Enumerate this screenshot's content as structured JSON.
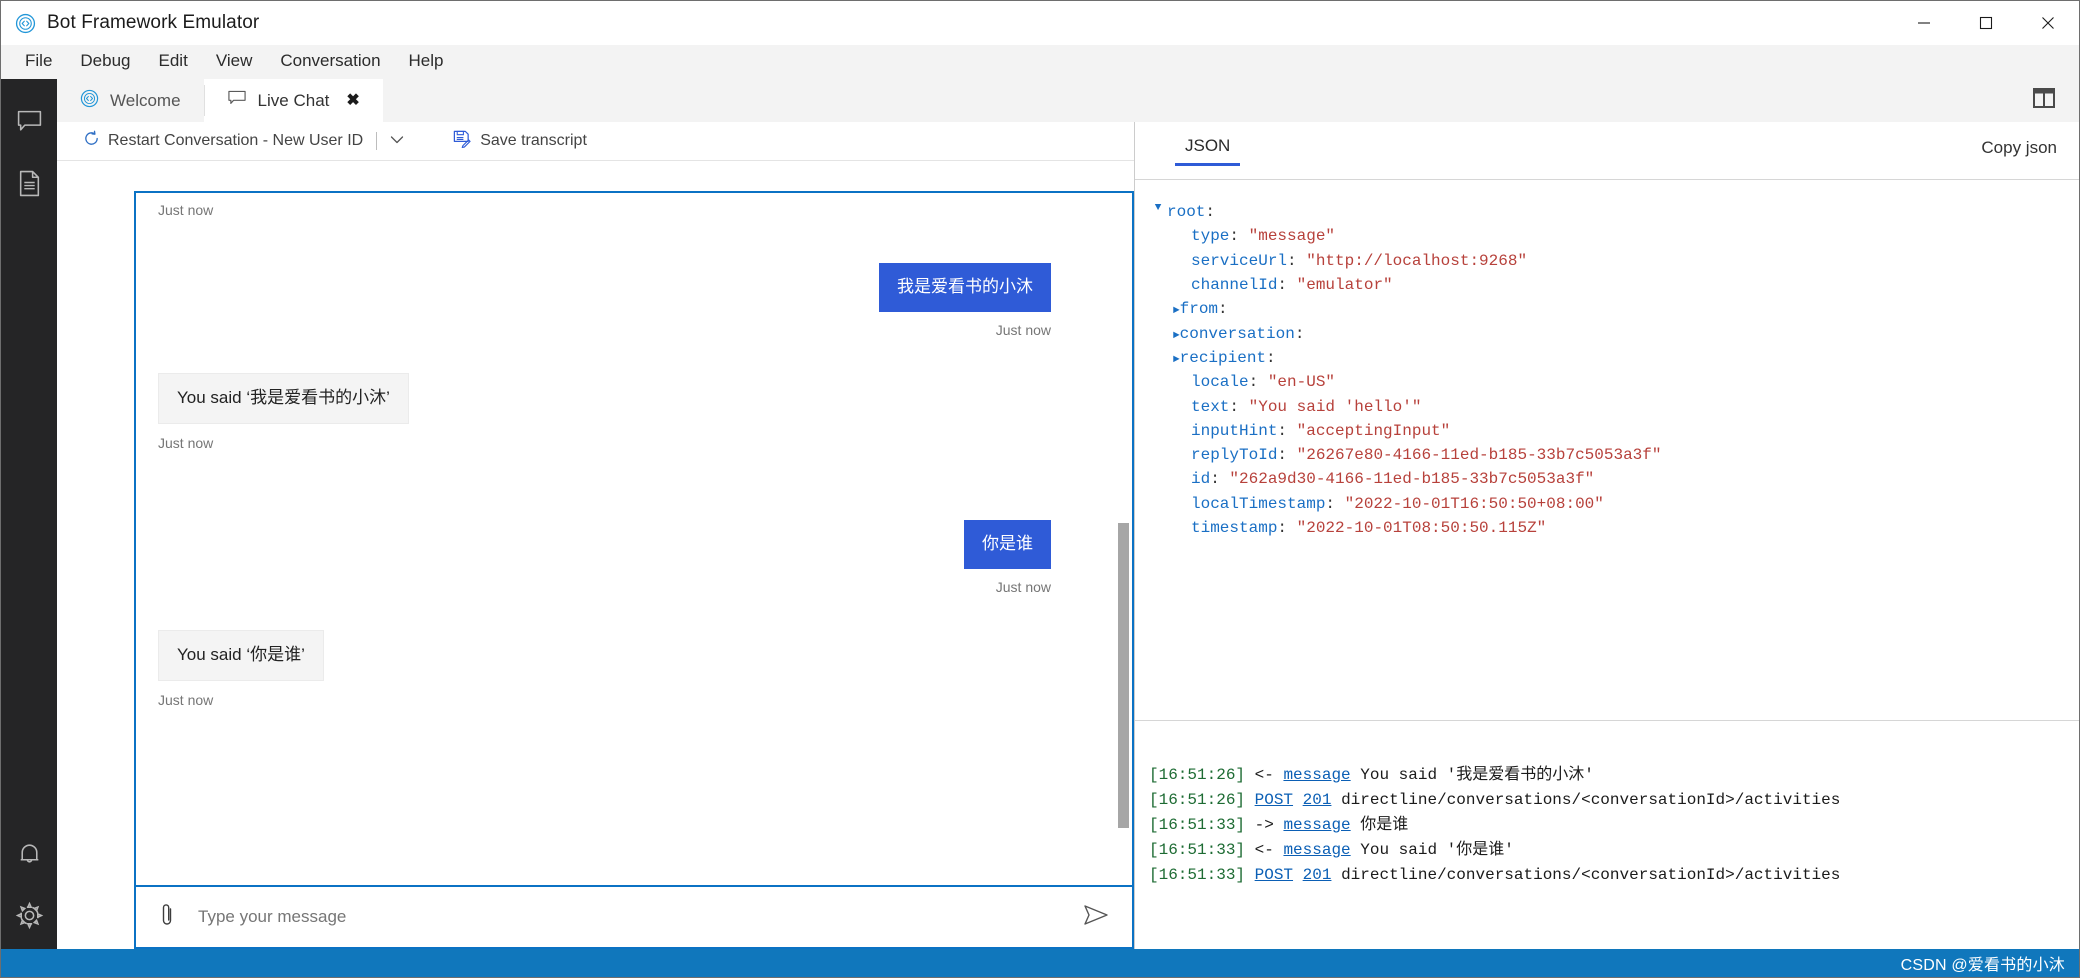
{
  "window": {
    "title": "Bot Framework Emulator",
    "logo_icon": "bot-framework-logo-icon",
    "controls": [
      {
        "name": "minimize-button",
        "icon": "minimize-icon"
      },
      {
        "name": "maximize-button",
        "icon": "maximize-icon"
      },
      {
        "name": "close-button",
        "icon": "close-icon"
      }
    ]
  },
  "menubar": {
    "items": [
      {
        "label": "File"
      },
      {
        "label": "Debug"
      },
      {
        "label": "Edit"
      },
      {
        "label": "View"
      },
      {
        "label": "Conversation"
      },
      {
        "label": "Help"
      }
    ]
  },
  "activity_bar": {
    "items": [
      {
        "name": "sidebar-item-chat",
        "icon": "chat-bubble-icon"
      },
      {
        "name": "sidebar-item-resources",
        "icon": "document-icon"
      },
      {
        "name": "sidebar-item-notifications",
        "icon": "bell-icon"
      },
      {
        "name": "sidebar-item-settings",
        "icon": "gear-icon"
      }
    ]
  },
  "tabs": {
    "items": [
      {
        "label": "Welcome",
        "icon": "bot-framework-logo-icon",
        "active": false,
        "closable": false
      },
      {
        "label": "Live Chat",
        "icon": "chat-bubble-icon",
        "active": true,
        "closable": true,
        "close_glyph": "✖"
      }
    ],
    "layout_button": {
      "name": "toggle-panel-layout-button",
      "icon": "split-panel-icon"
    }
  },
  "chat_toolbar": {
    "restart_label": "Restart Conversation - New User ID",
    "restart_icon": "restart-circular-arrow-icon",
    "restart_caret_icon": "chevron-down-icon",
    "save_transcript_label": "Save transcript",
    "save_transcript_icon": "save-disk-icon"
  },
  "transcript": {
    "top_timestamp": "Just now",
    "messages": [
      {
        "from": "user",
        "text": "我是爱看书的小沐",
        "timestamp": "Just now"
      },
      {
        "from": "bot",
        "text": "You said ‘我是爱看书的小沐’",
        "timestamp": "Just now"
      },
      {
        "from": "user",
        "text": "你是谁",
        "timestamp": "Just now"
      },
      {
        "from": "bot",
        "text": "You said ‘你是谁’",
        "timestamp": "Just now"
      }
    ],
    "user_bubble_color": "#2f5bd7",
    "bot_bubble_color": "#f4f4f4",
    "focus_border_color": "#0b72c4"
  },
  "composer": {
    "placeholder": "Type your message",
    "value": "",
    "attach_icon": "paperclip-icon",
    "send_icon": "send-paper-plane-icon"
  },
  "inspector": {
    "tabs": [
      {
        "label": "JSON",
        "active": true
      }
    ],
    "copy_json_label": "Copy json",
    "accent_color": "#2f5bd7",
    "json": {
      "root_label": "root",
      "root_expanded": true,
      "rows": [
        {
          "twisty": "none",
          "key": "type",
          "value": "\"message\""
        },
        {
          "twisty": "none",
          "key": "serviceUrl",
          "value": "\"http://localhost:9268\""
        },
        {
          "twisty": "none",
          "key": "channelId",
          "value": "\"emulator\""
        },
        {
          "twisty": "collapsed",
          "key": "from",
          "value": ""
        },
        {
          "twisty": "collapsed",
          "key": "conversation",
          "value": ""
        },
        {
          "twisty": "collapsed",
          "key": "recipient",
          "value": ""
        },
        {
          "twisty": "none",
          "key": "locale",
          "value": "\"en-US\""
        },
        {
          "twisty": "none",
          "key": "text",
          "value": "\"You said 'hello'\""
        },
        {
          "twisty": "none",
          "key": "inputHint",
          "value": "\"acceptingInput\""
        },
        {
          "twisty": "none",
          "key": "replyToId",
          "value": "\"26267e80-4166-11ed-b185-33b7c5053a3f\""
        },
        {
          "twisty": "none",
          "key": "id",
          "value": "\"262a9d30-4166-11ed-b185-33b7c5053a3f\""
        },
        {
          "twisty": "none",
          "key": "localTimestamp",
          "value": "\"2022-10-01T16:50:50+08:00\""
        },
        {
          "twisty": "none",
          "key": "timestamp",
          "value": "\"2022-10-01T08:50:50.115Z\""
        }
      ]
    }
  },
  "log": {
    "rows": [
      {
        "time": "[16:51:26]",
        "arrow": "<-",
        "link": "message",
        "code": "",
        "text": "You said '我是爱看书的小沐'"
      },
      {
        "time": "[16:51:26]",
        "arrow": "",
        "link": "POST",
        "code": "201",
        "text": "directline/conversations/<conversationId>/activities"
      },
      {
        "time": "[16:51:33]",
        "arrow": "->",
        "link": "message",
        "code": "",
        "text": "你是谁"
      },
      {
        "time": "[16:51:33]",
        "arrow": "<-",
        "link": "message",
        "code": "",
        "text": "You said '你是谁'"
      },
      {
        "time": "[16:51:33]",
        "arrow": "",
        "link": "POST",
        "code": "201",
        "text": "directline/conversations/<conversationId>/activities"
      }
    ]
  },
  "statusbar": {
    "watermark": "CSDN @爱看书的小沐",
    "background": "#1077bc"
  }
}
